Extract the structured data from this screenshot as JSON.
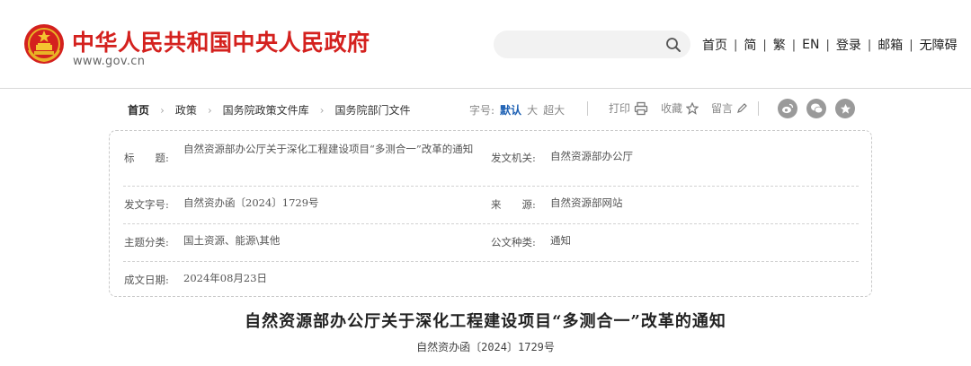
{
  "header": {
    "site_title": "中华人民共和国中央人民政府",
    "site_domain": "www.gov.cn",
    "search": {
      "placeholder": "",
      "icon": "search-icon"
    },
    "nav": [
      {
        "label": "首页"
      },
      {
        "label": "简"
      },
      {
        "label": "繁"
      },
      {
        "label": "EN"
      },
      {
        "label": "登录"
      },
      {
        "label": "邮箱"
      },
      {
        "label": "无障碍"
      }
    ]
  },
  "breadcrumb": [
    "首页",
    "政策",
    "国务院政策文件库",
    "国务院部门文件"
  ],
  "font_size": {
    "label": "字号:",
    "options": [
      "默认",
      "大",
      "超大"
    ],
    "selected": "默认"
  },
  "tools": {
    "print": "打印",
    "favorite": "收藏",
    "comment": "留言"
  },
  "share": [
    "weibo-icon",
    "wechat-icon",
    "star-icon"
  ],
  "info": {
    "title_label": "标　　题:",
    "title_value": "自然资源部办公厅关于深化工程建设项目“多测合一”改革的通知",
    "issuer_label": "发文机关:",
    "issuer_value": "自然资源部办公厅",
    "doc_no_label": "发文字号:",
    "doc_no_value": "自然资办函〔2024〕1729号",
    "source_label": "来　　源:",
    "source_value": "自然资源部网站",
    "topic_label": "主题分类:",
    "topic_value": "国土资源、能源\\其他",
    "type_label": "公文种类:",
    "type_value": "通知",
    "date_label": "成文日期:",
    "date_value": "2024年08月23日"
  },
  "document": {
    "title": "自然资源部办公厅关于深化工程建设项目“多测合一”改革的通知",
    "number": "自然资办函〔2024〕1729号"
  },
  "colors": {
    "brand_red": "#d4211e",
    "link_blue": "#1b5fb3",
    "gray_icon": "#9a9a9a"
  }
}
